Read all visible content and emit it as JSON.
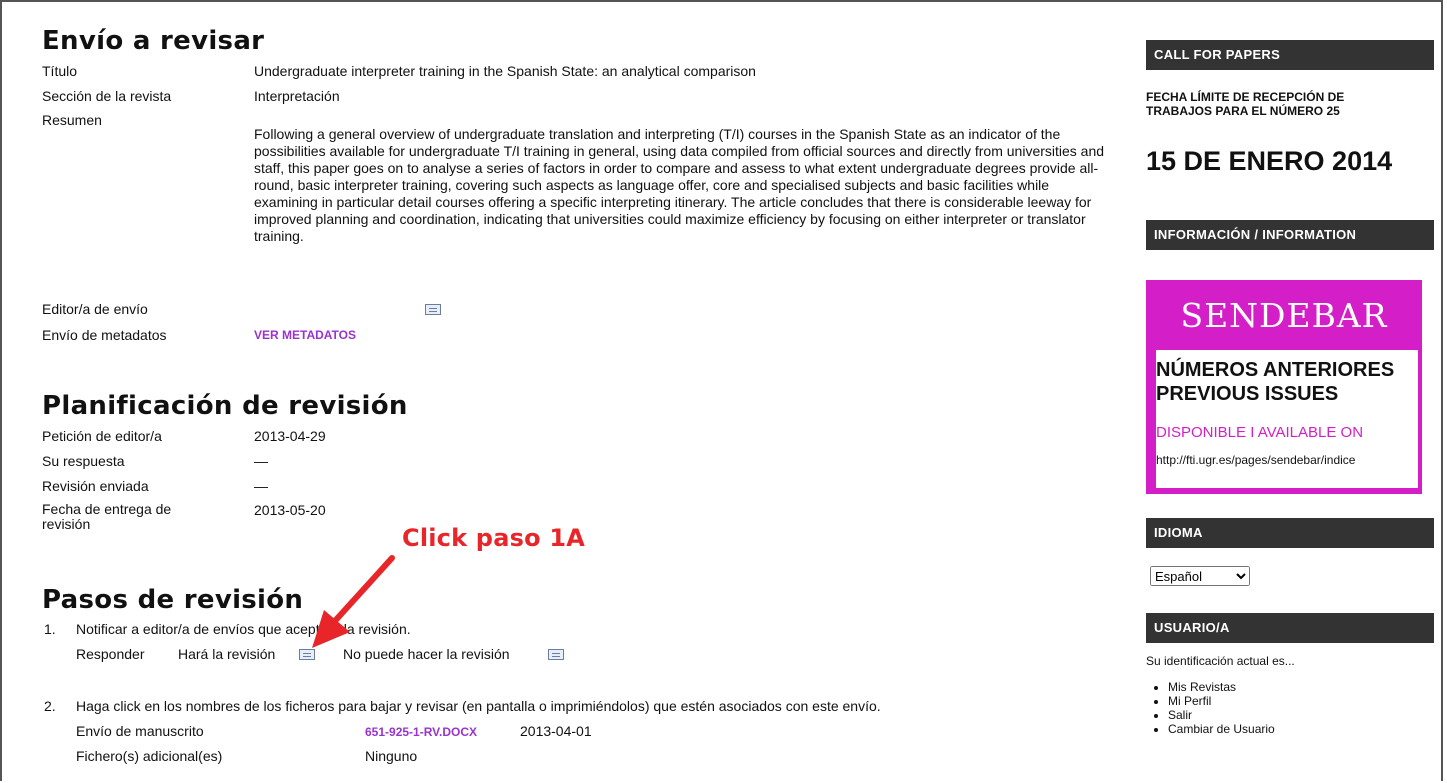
{
  "envio": {
    "heading": "Envío a revisar",
    "titulo_label": "Título",
    "titulo_value": "Undergraduate interpreter training in the Spanish State: an analytical comparison",
    "seccion_label": "Sección de la revista",
    "seccion_value": "Interpretación",
    "resumen_label": "Resumen",
    "resumen_value": "Following a general overview of undergraduate translation and interpreting (T/I) courses in the Spanish State as an indicator of the possibilities available for undergraduate T/I training in general, using data compiled from official sources and directly from universities and staff, this paper goes on to analyse a series of factors in order to compare and assess to what extent undergraduate degrees provide all-round, basic interpreter training, covering such aspects as language offer, core and specialised subjects and basic facilities while examining in particular detail courses offering a specific interpreting itinerary. The article concludes that there is considerable leeway for improved planning and coordination, indicating that universities could maximize efficiency by focusing on either interpreter or translator training.",
    "editor_label": "Editor/a de envío",
    "metadatos_label": "Envío de metadatos",
    "metadatos_link": "VER METADATOS"
  },
  "planificacion": {
    "heading": "Planificación de revisión",
    "rows": [
      {
        "label": "Petición de editor/a",
        "value": "2013-04-29"
      },
      {
        "label": "Su respuesta",
        "value": "—"
      },
      {
        "label": "Revisión enviada",
        "value": "—"
      },
      {
        "label": "Fecha de entrega de revisión",
        "value": "2013-05-20"
      }
    ]
  },
  "pasos": {
    "heading": "Pasos de revisión",
    "step1_num": "1.",
    "step1_text": "Notificar a editor/a de envíos que aceptará la revisión.",
    "responder_label": "Responder",
    "hara_label": "Hará la revisión",
    "no_puede_label": "No puede hacer la revisión",
    "step2_num": "2.",
    "step2_text": "Haga click en los nombres de los ficheros para bajar y revisar (en pantalla o imprimiéndolos) que estén asociados con este envío.",
    "manuscrito_label": "Envío de manuscrito",
    "manuscrito_file": "651-925-1-RV.DOCX",
    "manuscrito_date": "2013-04-01",
    "adicional_label": "Fichero(s) adicional(es)",
    "adicional_value": "Ninguno"
  },
  "annotation": {
    "text": "Click paso 1A",
    "color": "#e8262a"
  },
  "sidebar": {
    "call_head": "CALL FOR PAPERS",
    "call_line1": "FECHA LÍMITE DE RECEPCIÓN DE",
    "call_line2": "TRABAJOS PARA EL NÚMERO 25",
    "call_date": "15 DE ENERO 2014",
    "info_head": "INFORMACIÓN / INFORMATION",
    "banner_title": "SENDEBAR",
    "banner_line1": "NÚMEROS ANTERIORES",
    "banner_line2": "PREVIOUS ISSUES",
    "banner_line3": "DISPONIBLE I AVAILABLE ON",
    "banner_url": "http://fti.ugr.es/pages/sendebar/indice",
    "banner_color": "#d41ec8",
    "idioma_head": "IDIOMA",
    "idioma_selected": "Español",
    "usuario_head": "USUARIO/A",
    "usuario_text": "Su identificación actual es...",
    "usuario_links": [
      "Mis Revistas",
      "Mi Perfil",
      "Salir",
      "Cambiar de Usuario"
    ]
  }
}
